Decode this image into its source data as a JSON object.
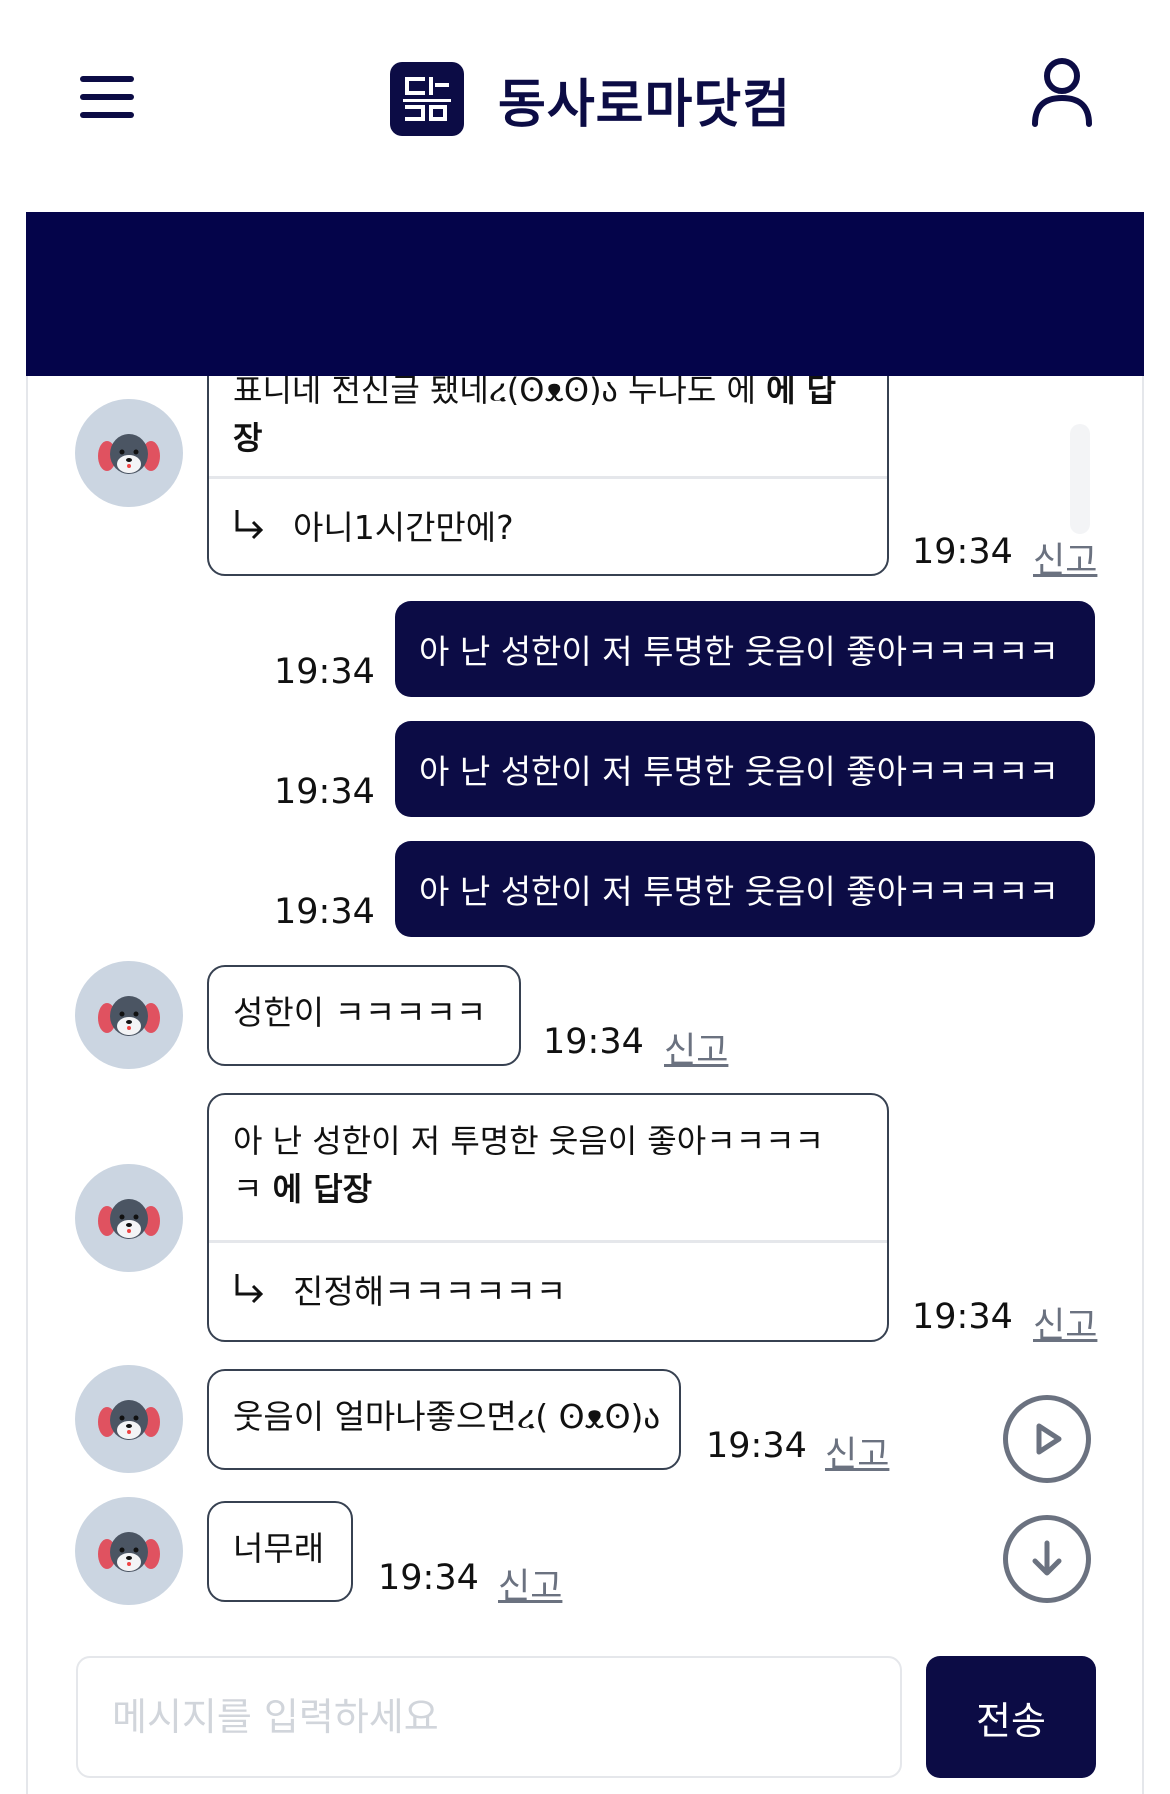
{
  "header": {
    "site_title": "동사로마닷컴",
    "logo_text": "동사로마"
  },
  "messages": {
    "m1": {
      "reply_target_partial": "표니네 전신글 됐네ረ(ʘᴥʘ)ა 누나도 에",
      "reply_suffix": "에 답장",
      "reply_text": "아니1시간만에?",
      "time": "19:34",
      "report": "신고"
    },
    "mine": [
      {
        "text": "아 난 성한이 저 투명한 웃음이 좋아ㅋㅋㅋㅋㅋ",
        "time": "19:34"
      },
      {
        "text": "아 난 성한이 저 투명한 웃음이 좋아ㅋㅋㅋㅋㅋ",
        "time": "19:34"
      },
      {
        "text": "아 난 성한이 저 투명한 웃음이 좋아ㅋㅋㅋㅋㅋ",
        "time": "19:34"
      }
    ],
    "m5": {
      "text": "성한이 ㅋㅋㅋㅋㅋ",
      "time": "19:34",
      "report": "신고"
    },
    "m6": {
      "reply_target": "아 난 성한이 저 투명한 웃음이 좋아ㅋㅋㅋㅋ ㅋ",
      "reply_suffix": "에 답장",
      "reply_text": "진정해ㅋㅋㅋㅋㅋㅋ",
      "time": "19:34",
      "report": "신고"
    },
    "m7": {
      "text": "웃음이 얼마나좋으면ረ( ʘᴥʘ)ა",
      "time": "19:34",
      "report": "신고"
    },
    "m8": {
      "text": "너무래",
      "time": "19:34",
      "report": "신고"
    }
  },
  "composer": {
    "placeholder": "메시지를 입력하세요",
    "send_label": "전송"
  },
  "colors": {
    "brand_navy": "#0c0c45",
    "banner": "#04044a",
    "avatar_bg": "#cbd5e1"
  },
  "icons": [
    "menu-icon",
    "user-icon",
    "reply-arrow-icon",
    "play-icon",
    "arrow-down-icon",
    "dog-avatar-icon"
  ]
}
